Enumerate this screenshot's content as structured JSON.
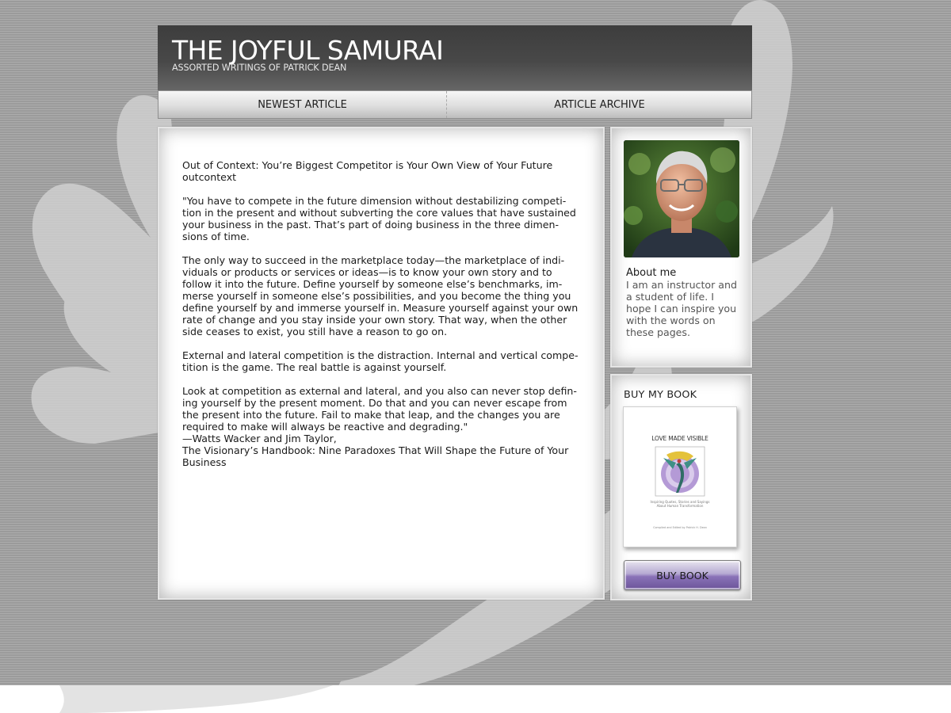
{
  "header": {
    "title": "THE JOYFUL SAMURAI",
    "subtitle": "ASSORTED WRITINGS OF PATRICK DEAN"
  },
  "nav": {
    "items": [
      {
        "label": "NEWEST ARTICLE"
      },
      {
        "label": "ARTICLE ARCHIVE"
      }
    ]
  },
  "article": {
    "title_lines": [
      "Out of Context: You’re Biggest Competitor is Your Own View of Your Future",
      "outcontext"
    ],
    "paragraphs": [
      [
        "\"You have to compete in the future dimension without destabilizing competi-",
        "tion in the present and without subverting the core values that have sustained",
        "your business in the past. That’s part of doing business in the three dimen-",
        "sions of time."
      ],
      [
        "The only way to succeed in the marketplace today—the marketplace of indi-",
        "viduals or products or services or ideas—is to know your own story and to",
        "follow it into the future. Define yourself by someone else’s benchmarks, im-",
        "merse yourself in someone else’s possibilities, and you become the thing you",
        "define yourself by and immerse yourself in. Measure yourself against your own",
        "rate of change and you stay inside your own story. That way, when the other",
        "side ceases to exist, you still have a reason to go on."
      ],
      [
        "External and lateral competition is the distraction. Internal and vertical compe-",
        "tition is the game. The real battle is against yourself."
      ],
      [
        "Look at competition as external and lateral, and you also can never stop defin-",
        "ing yourself by the present moment. Do that and you can never escape from",
        "the present into the future. Fail to make that leap, and the changes you are",
        "required to make will always be reactive and degrading.\"",
        "—Watts Wacker and Jim Taylor,",
        "The Visionary’s Handbook: Nine Paradoxes That Will Shape the Future of Your",
        "Business"
      ]
    ]
  },
  "about": {
    "heading": "About me",
    "text_lines": [
      "I am an instructor and",
      "a student of life. I",
      "hope I can inspire you",
      "with the words on",
      "these pages."
    ]
  },
  "book": {
    "heading": "BUY MY BOOK",
    "cover_title": "LOVE MADE VISIBLE",
    "cover_subtitle_lines": [
      "Inspiring Quotes, Stories and Sayings",
      "About Human Transformation"
    ],
    "cover_credit": "Compiled and Edited by Patrick H. Dean",
    "button_label": "BUY BOOK"
  },
  "colors": {
    "background": "#a3a3a3",
    "header": "#484848",
    "accent_purple": "#8a72b8"
  }
}
